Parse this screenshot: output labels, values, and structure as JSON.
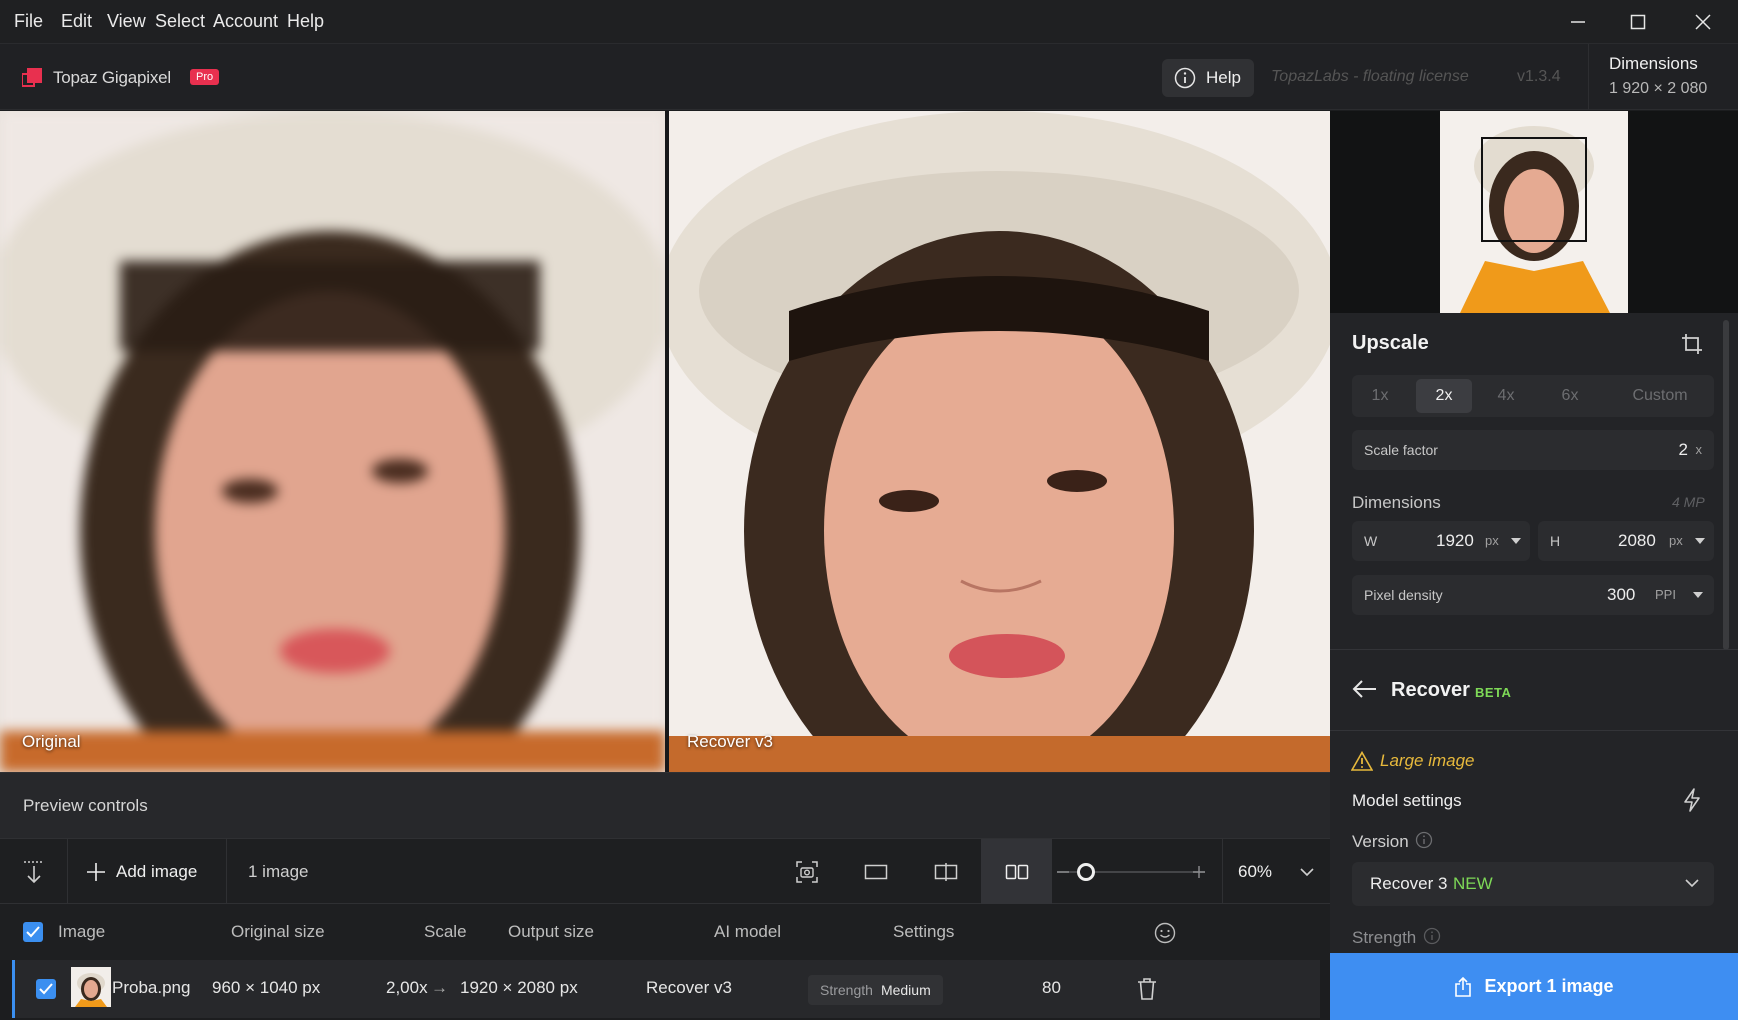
{
  "menu": [
    "File",
    "Edit",
    "View",
    "Select",
    "Account",
    "Help"
  ],
  "app": {
    "name": "Topaz Gigapixel",
    "badge": "Pro",
    "help_label": "Help",
    "license": "TopazLabs - floating license",
    "version": "v1.3.4"
  },
  "dimensions_header": {
    "title": "Dimensions",
    "value": "1 920 × 2 080"
  },
  "preview": {
    "left_label": "Original",
    "right_label": "Recover v3",
    "controls_label": "Preview controls"
  },
  "upscale": {
    "title": "Upscale",
    "scale_options": [
      "1x",
      "2x",
      "4x",
      "6x",
      "Custom"
    ],
    "selected_scale": "2x",
    "scale_factor_label": "Scale factor",
    "scale_factor_value": "2",
    "scale_factor_unit": "x",
    "dimensions_label": "Dimensions",
    "megapixels": "4 MP",
    "width_label": "W",
    "width_value": "1920",
    "width_unit": "px",
    "height_label": "H",
    "height_value": "2080",
    "height_unit": "px",
    "density_label": "Pixel density",
    "density_value": "300",
    "density_unit": "PPI"
  },
  "recover": {
    "title": "Recover",
    "badge": "BETA",
    "warning": "Large image",
    "model_settings_label": "Model settings",
    "version_label": "Version",
    "version_value": "Recover 3",
    "version_new": "NEW",
    "strength_label": "Strength"
  },
  "export_label": "Export 1 image",
  "toolbar": {
    "add_image_label": "Add image",
    "image_count": "1 image",
    "zoom": "60%"
  },
  "table": {
    "headers": {
      "image": "Image",
      "original_size": "Original size",
      "scale": "Scale",
      "output_size": "Output size",
      "ai_model": "AI model",
      "settings": "Settings"
    },
    "row": {
      "name": "Proba.png",
      "original_size": "960 × 1040 px",
      "scale": "2,00x",
      "arrow": "→",
      "output_size": "1920 × 2080 px",
      "ai_model": "Recover v3",
      "settings_label": "Strength",
      "settings_value": "Medium",
      "value": "80"
    }
  },
  "colors": {
    "accent": "#3e8ef2",
    "brand": "#e8304f",
    "warning": "#e7b93c",
    "beta": "#7ed957"
  }
}
